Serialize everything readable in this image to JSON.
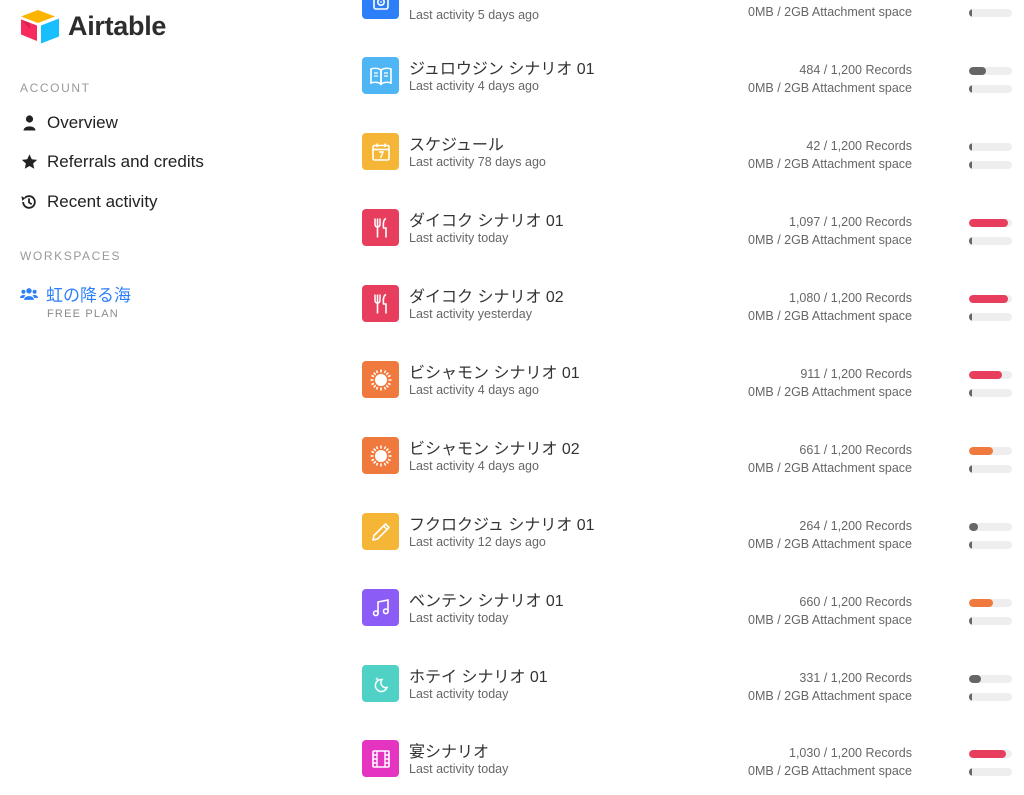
{
  "brand": {
    "name": "Airtable"
  },
  "sidebar": {
    "account_label": "ACCOUNT",
    "items": [
      {
        "label": "Overview",
        "icon": "user-icon"
      },
      {
        "label": "Referrals and credits",
        "icon": "star-icon"
      },
      {
        "label": "Recent activity",
        "icon": "history-icon"
      }
    ],
    "workspaces_label": "WORKSPACES",
    "workspace": {
      "name": "虹の降る海",
      "plan": "FREE PLAN",
      "icon": "users-icon"
    }
  },
  "colors": {
    "accent": "#2d7ff9",
    "bar_red": "#e83e5e",
    "bar_orange": "#f07a3e",
    "bar_gray": "#666666",
    "bar_track": "#eeeeee"
  },
  "bases": [
    {
      "name": "",
      "activity": "Last activity 5 days ago",
      "records": "",
      "attachment": "0MB / 2GB Attachment space",
      "records_fraction": 0.0,
      "attach_fraction": 0.02,
      "icon": "disc-icon",
      "icon_color": "#2d7ff9",
      "bar_color": "#666666"
    },
    {
      "name": "ジュロウジン シナリオ 01",
      "activity": "Last activity 4 days ago",
      "records": "484 / 1,200 Records",
      "attachment": "0MB / 2GB Attachment space",
      "records_fraction": 0.403,
      "attach_fraction": 0.02,
      "icon": "book-icon",
      "icon_color": "#4fb6f5",
      "bar_color": "#666666"
    },
    {
      "name": "スケジュール",
      "activity": "Last activity 78 days ago",
      "records": "42 / 1,200 Records",
      "attachment": "0MB / 2GB Attachment space",
      "records_fraction": 0.035,
      "attach_fraction": 0.02,
      "icon": "calendar-icon",
      "icon_color": "#f5b638",
      "bar_color": "#666666"
    },
    {
      "name": "ダイコク シナリオ 01",
      "activity": "Last activity today",
      "records": "1,097 / 1,200 Records",
      "attachment": "0MB / 2GB Attachment space",
      "records_fraction": 0.914,
      "attach_fraction": 0.02,
      "icon": "utensils-icon",
      "icon_color": "#e83e5e",
      "bar_color": "#e83e5e"
    },
    {
      "name": "ダイコク シナリオ 02",
      "activity": "Last activity yesterday",
      "records": "1,080 / 1,200 Records",
      "attachment": "0MB / 2GB Attachment space",
      "records_fraction": 0.9,
      "attach_fraction": 0.02,
      "icon": "utensils-icon",
      "icon_color": "#e83e5e",
      "bar_color": "#e83e5e"
    },
    {
      "name": "ビシャモン シナリオ 01",
      "activity": "Last activity 4 days ago",
      "records": "911 / 1,200 Records",
      "attachment": "0MB / 2GB Attachment space",
      "records_fraction": 0.759,
      "attach_fraction": 0.02,
      "icon": "sun-icon",
      "icon_color": "#f07a3e",
      "bar_color": "#e83e5e"
    },
    {
      "name": "ビシャモン シナリオ 02",
      "activity": "Last activity 4 days ago",
      "records": "661 / 1,200 Records",
      "attachment": "0MB / 2GB Attachment space",
      "records_fraction": 0.551,
      "attach_fraction": 0.02,
      "icon": "sun-icon",
      "icon_color": "#f07a3e",
      "bar_color": "#f07a3e"
    },
    {
      "name": "フクロクジュ シナリオ 01",
      "activity": "Last activity 12 days ago",
      "records": "264 / 1,200 Records",
      "attachment": "0MB / 2GB Attachment space",
      "records_fraction": 0.22,
      "attach_fraction": 0.02,
      "icon": "pencil-icon",
      "icon_color": "#f5b638",
      "bar_color": "#666666"
    },
    {
      "name": "ベンテン シナリオ 01",
      "activity": "Last activity today",
      "records": "660 / 1,200 Records",
      "attachment": "0MB / 2GB Attachment space",
      "records_fraction": 0.55,
      "attach_fraction": 0.02,
      "icon": "music-icon",
      "icon_color": "#8b5cf6",
      "bar_color": "#f07a3e"
    },
    {
      "name": "ホテイ シナリオ 01",
      "activity": "Last activity today",
      "records": "331 / 1,200 Records",
      "attachment": "0MB / 2GB Attachment space",
      "records_fraction": 0.276,
      "attach_fraction": 0.02,
      "icon": "moon-icon",
      "icon_color": "#4fd1c5",
      "bar_color": "#666666"
    },
    {
      "name": "宴シナリオ",
      "activity": "Last activity today",
      "records": "1,030 / 1,200 Records",
      "attachment": "0MB / 2GB Attachment space",
      "records_fraction": 0.858,
      "attach_fraction": 0.02,
      "icon": "film-icon",
      "icon_color": "#e535c0",
      "bar_color": "#e83e5e"
    }
  ]
}
